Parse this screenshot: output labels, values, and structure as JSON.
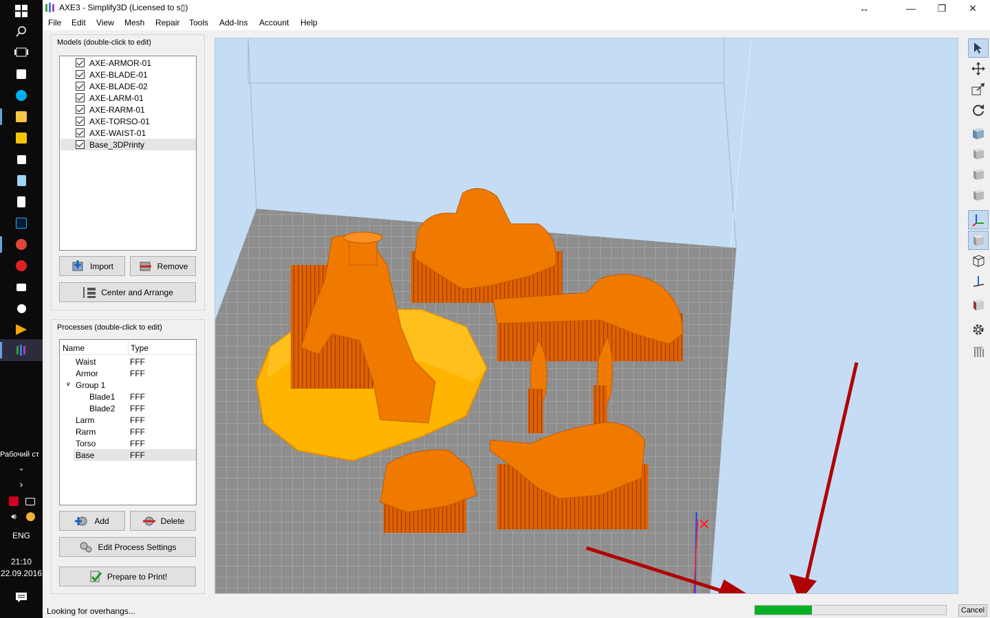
{
  "taskbar": {
    "desktop_label": "Рабочий ст",
    "language": "ENG",
    "time": "21:10",
    "date": "22.09.2016"
  },
  "window": {
    "title": "AXE3 - Simplify3D (Licensed to s▯)",
    "buttons": {
      "resize": "↔",
      "minimize": "—",
      "maximize": "❐",
      "close": "✕"
    }
  },
  "menu": [
    "File",
    "Edit",
    "View",
    "Mesh",
    "Repair",
    "Tools",
    "Add-Ins",
    "Account",
    "Help"
  ],
  "models": {
    "title": "Models (double-click to edit)",
    "items": [
      {
        "label": "AXE-ARMOR-01",
        "checked": true
      },
      {
        "label": "AXE-BLADE-01",
        "checked": true
      },
      {
        "label": "AXE-BLADE-02",
        "checked": true
      },
      {
        "label": "AXE-LARM-01",
        "checked": true
      },
      {
        "label": "AXE-RARM-01",
        "checked": true
      },
      {
        "label": "AXE-TORSO-01",
        "checked": true
      },
      {
        "label": "AXE-WAIST-01",
        "checked": true
      },
      {
        "label": "Base_3DPrinty",
        "checked": true,
        "selected": true
      }
    ],
    "import_label": "Import",
    "remove_label": "Remove",
    "center_arrange_label": "Center and Arrange"
  },
  "processes": {
    "title": "Processes (double-click to edit)",
    "col_name": "Name",
    "col_type": "Type",
    "rows": [
      {
        "name": "Waist",
        "type": "FFF",
        "indent": 0
      },
      {
        "name": "Armor",
        "type": "FFF",
        "indent": 0
      },
      {
        "name": "Group 1",
        "type": "",
        "indent": 0,
        "expander": "∨"
      },
      {
        "name": "Blade1",
        "type": "FFF",
        "indent": 1
      },
      {
        "name": "Blade2",
        "type": "FFF",
        "indent": 1
      },
      {
        "name": "Larm",
        "type": "FFF",
        "indent": 0
      },
      {
        "name": "Rarm",
        "type": "FFF",
        "indent": 0
      },
      {
        "name": "Torso",
        "type": "FFF",
        "indent": 0
      },
      {
        "name": "Base",
        "type": "FFF",
        "indent": 0,
        "selected": true
      }
    ],
    "add_label": "Add",
    "delete_label": "Delete",
    "edit_settings_label": "Edit Process Settings",
    "prepare_label": "Prepare to Print!"
  },
  "right_toolbar": [
    {
      "icon": "select-arrow-icon",
      "active": true
    },
    {
      "icon": "move-icon"
    },
    {
      "icon": "scale-icon"
    },
    {
      "icon": "rotate-icon"
    },
    {
      "icon": "view-iso-cube-icon"
    },
    {
      "icon": "view-front-cube-icon"
    },
    {
      "icon": "view-side-cube-icon"
    },
    {
      "icon": "view-top-cube-icon"
    },
    {
      "icon": "axes-icon",
      "active": true
    },
    {
      "icon": "solid-cube-icon",
      "active": true
    },
    {
      "icon": "wireframe-cube-icon"
    },
    {
      "icon": "cross-section-icon"
    },
    {
      "icon": "section-cube-icon"
    },
    {
      "icon": "gear-icon"
    },
    {
      "icon": "support-pillars-icon"
    }
  ],
  "status": {
    "text": "Looking for overhangs...",
    "progress": 0.3,
    "cancel_label": "Cancel"
  },
  "colors": {
    "model_orange": "#f07a00",
    "base_yellow": "#ffb400",
    "bed_gray": "#8c8c8c",
    "sky_blue": "#c4ddf4",
    "annotation_red": "#b00000",
    "progress_green": "#06b025"
  }
}
